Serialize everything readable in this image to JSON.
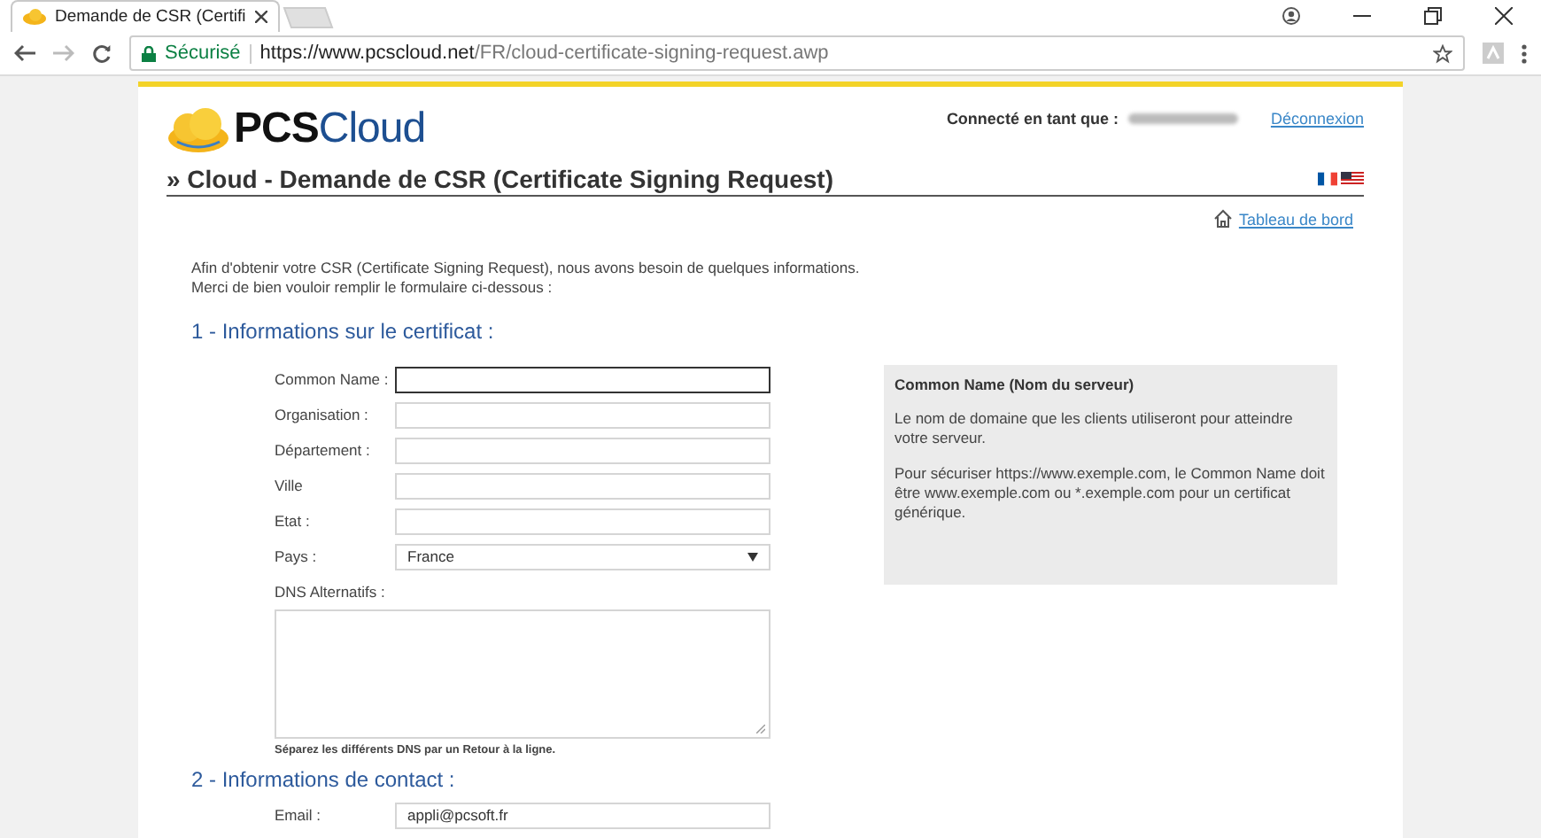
{
  "browser": {
    "tab": {
      "title": "Demande de CSR (Certifi",
      "selected": true
    },
    "address": {
      "secure_label": "Sécurisé",
      "url_host": "https://www.pcscloud.net",
      "url_path": "/FR/cloud-certificate-signing-request.awp"
    }
  },
  "header": {
    "logo_prefix": "PCS",
    "logo_suffix": "Cloud",
    "connected_label": "Connecté en tant que :",
    "logout": "Déconnexion"
  },
  "page_title": "» Cloud - Demande de CSR (Certificate Signing Request)",
  "dashboard_link": "Tableau de bord",
  "intro": [
    "Afin d'obtenir votre CSR (Certificate Signing Request), nous avons besoin de quelques informations.",
    "Merci de bien vouloir remplir le formulaire ci-dessous :"
  ],
  "section1": {
    "heading": "1 - Informations sur le certificat :",
    "fields": [
      {
        "kind": "text",
        "label": "Common Name :",
        "focused": true
      },
      {
        "kind": "text",
        "label": "Organisation :",
        "focused": false
      },
      {
        "kind": "text",
        "label": "Département :",
        "focused": false
      },
      {
        "kind": "text",
        "label": "Ville",
        "focused": false
      },
      {
        "kind": "text",
        "label": "Etat :",
        "focused": false
      },
      {
        "kind": "select",
        "label": "Pays :",
        "value": "France",
        "focused": false
      }
    ],
    "dns_label": "DNS Alternatifs :",
    "dns_hint": "Séparez les différents DNS par un Retour à la ligne."
  },
  "help": {
    "title": "Common Name (Nom du serveur)",
    "paragraphs": [
      "Le nom de domaine que les clients utiliseront pour atteindre votre serveur.",
      "Pour sécuriser https://www.exemple.com, le Common Name doit être www.exemple.com ou *.exemple.com pour un certificat générique."
    ]
  },
  "section2": {
    "heading": "2 - Informations de contact :",
    "fields": [
      {
        "kind": "text",
        "label": "Email :",
        "value": "appli@pcsoft.fr",
        "focused": false
      }
    ]
  }
}
